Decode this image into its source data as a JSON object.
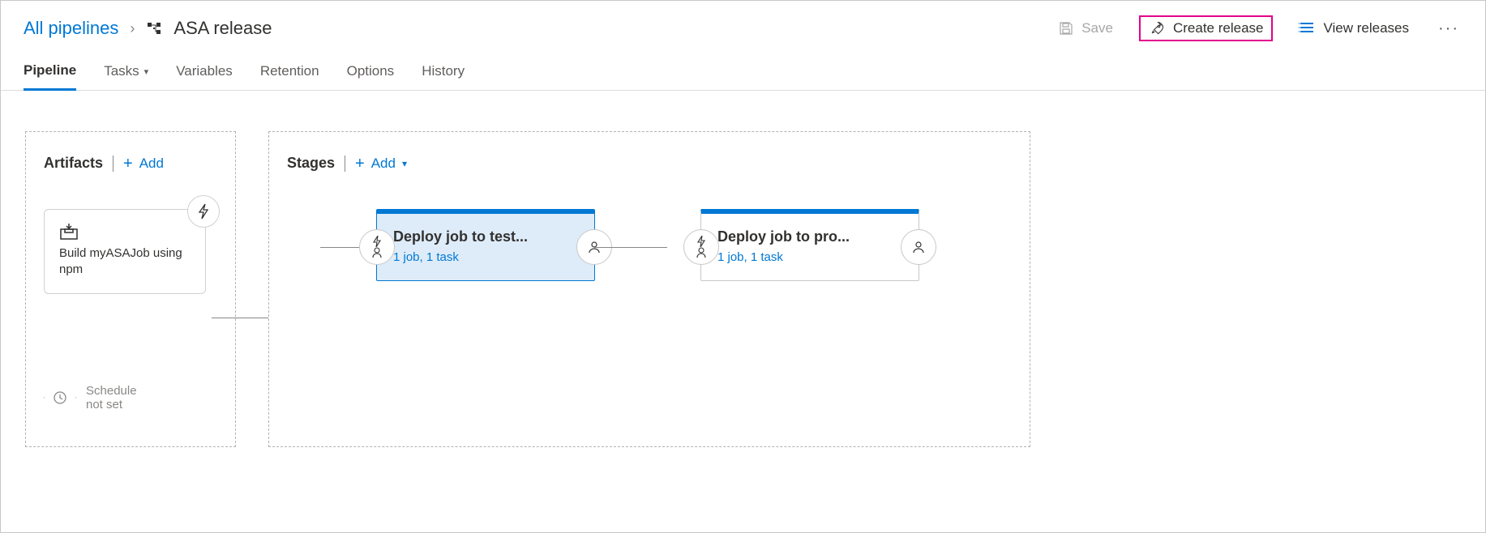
{
  "breadcrumb": {
    "root": "All pipelines",
    "title": "ASA release"
  },
  "actions": {
    "save": "Save",
    "create_release": "Create release",
    "view_releases": "View releases"
  },
  "tabs": {
    "pipeline": "Pipeline",
    "tasks": "Tasks",
    "variables": "Variables",
    "retention": "Retention",
    "options": "Options",
    "history": "History"
  },
  "panels": {
    "artifacts_title": "Artifacts",
    "stages_title": "Stages",
    "add": "Add"
  },
  "artifact": {
    "name": "Build myASAJob using npm"
  },
  "schedule": {
    "line1": "Schedule",
    "line2": "not set"
  },
  "stages": [
    {
      "name": "Deploy job to test...",
      "meta": "1 job, 1 task",
      "selected": true
    },
    {
      "name": "Deploy job to pro...",
      "meta": "1 job, 1 task",
      "selected": false
    }
  ]
}
